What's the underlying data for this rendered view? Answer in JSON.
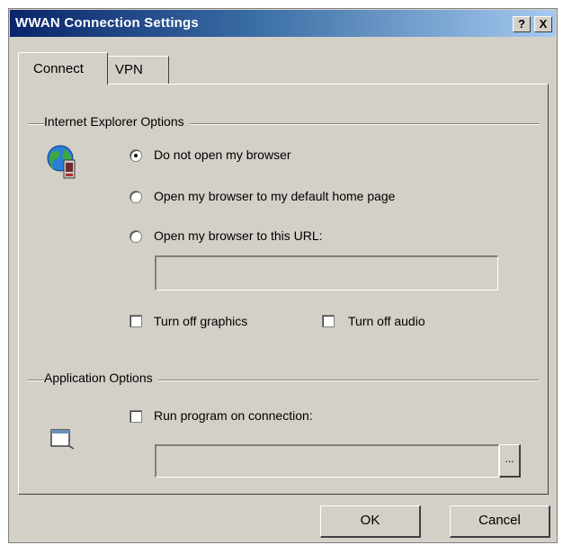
{
  "window": {
    "title": "WWAN Connection Settings",
    "help_label": "?",
    "close_label": "X"
  },
  "tabs": [
    {
      "label": "Connect",
      "active": true
    },
    {
      "label": "VPN",
      "active": false
    }
  ],
  "ie_options": {
    "group_label": "Internet Explorer Options",
    "icon": "ie-globe-icon",
    "radios": [
      {
        "label": "Do not open my browser",
        "checked": true
      },
      {
        "label": "Open my browser to my default home page",
        "checked": false
      },
      {
        "label": "Open my browser to this URL:",
        "checked": false
      }
    ],
    "url_value": "",
    "checkboxes": [
      {
        "label": "Turn off graphics",
        "checked": false
      },
      {
        "label": "Turn off audio",
        "checked": false
      }
    ]
  },
  "app_options": {
    "group_label": "Application Options",
    "icon": "application-window-icon",
    "checkbox": {
      "label": "Run program on connection:",
      "checked": false
    },
    "program_value": "",
    "browse_label": "..."
  },
  "buttons": {
    "ok_label": "OK",
    "cancel_label": "Cancel"
  }
}
